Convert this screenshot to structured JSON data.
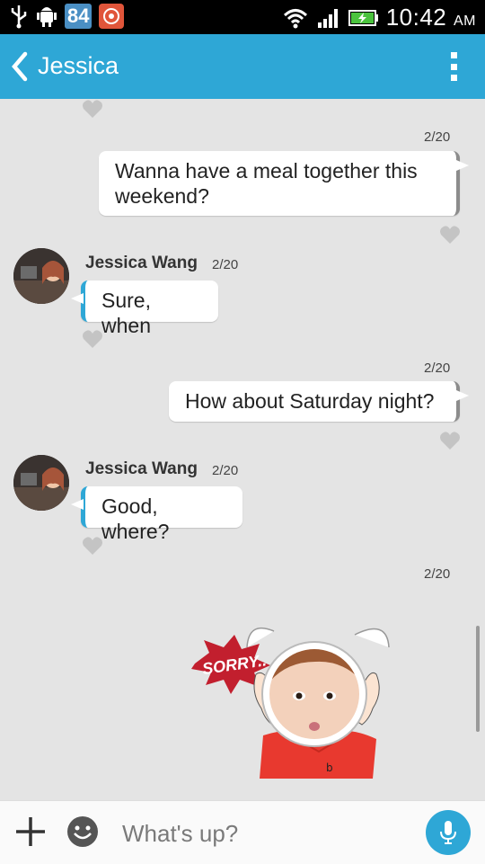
{
  "status_bar": {
    "battery_badge": "84",
    "time": "10:42",
    "ampm": "AM",
    "icons": [
      "usb-icon",
      "android-debug-icon",
      "notification-app-icon",
      "wifi-icon",
      "signal-icon",
      "battery-charging-icon"
    ]
  },
  "header": {
    "title": "Jessica",
    "back_icon": "chevron-left-icon",
    "menu_icon": "kebab-menu-icon"
  },
  "messages": [
    {
      "direction": "out",
      "date": "2/20",
      "text": "Wanna have a meal together this weekend?"
    },
    {
      "direction": "in",
      "sender": "Jessica Wang",
      "date": "2/20",
      "text": "Sure, when"
    },
    {
      "direction": "out",
      "date": "2/20",
      "text": "How about Saturday night?"
    },
    {
      "direction": "in",
      "sender": "Jessica Wang",
      "date": "2/20",
      "text": "Good, where?"
    },
    {
      "direction": "out",
      "date": "2/20",
      "sticker": "SORRY.."
    }
  ],
  "input_bar": {
    "placeholder": "What's up?",
    "icons": [
      "plus-icon",
      "emoji-icon",
      "microphone-icon"
    ]
  },
  "colors": {
    "accent": "#2ea7d6",
    "background": "#e4e4e4",
    "heart": "#c4c4c4"
  }
}
